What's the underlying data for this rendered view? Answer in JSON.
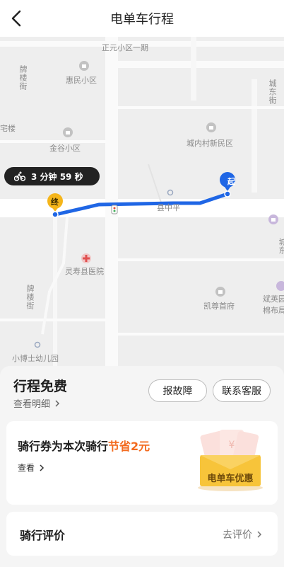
{
  "header": {
    "title": "电单车行程"
  },
  "map": {
    "labels": {
      "zhengyuan": "正元小区一期",
      "pailoujie_top": "牌楼街",
      "huimin": "惠民小区",
      "chengdongjie": "城东街",
      "zhailou": "宅楼",
      "jingu": "金谷小区",
      "chengneicun": "城内村新民区",
      "road": "县中平",
      "hospital": "灵寿县医院",
      "pailoujie_bottom": "牌楼街",
      "kaizun": "凯尊首府",
      "binying": "斌英园",
      "mianbu": "棉布局",
      "kindergarten": "小博士幼儿园",
      "dong": "城东"
    },
    "start_marker": "起",
    "end_marker": "终",
    "ride_time": "3 分钟 59 秒"
  },
  "trip": {
    "fee_title": "行程免费",
    "detail_link": "查看明细",
    "report_button": "报故障",
    "contact_button": "联系客服"
  },
  "coupon": {
    "title_prefix": "骑行券为本次骑行",
    "title_accent": "节省2元",
    "view_link": "查看",
    "envelope_text": "电单车优惠"
  },
  "rating": {
    "title": "骑行评价",
    "link": "去评价"
  },
  "colors": {
    "route": "#1f66e5",
    "accent": "#f36a1e",
    "start_marker": "#1f66e5",
    "end_marker": "#f5b51a",
    "envelope": "#f7c43a"
  }
}
